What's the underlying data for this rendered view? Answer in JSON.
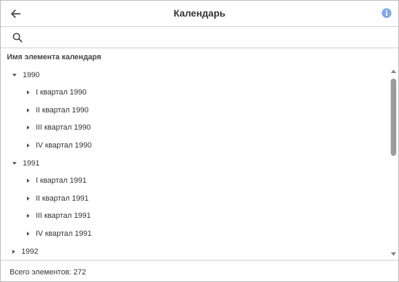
{
  "header": {
    "title": "Календарь",
    "back_icon": "arrow-left-icon",
    "info_icon": "info-circle-icon",
    "info_color": "#7fa9e6"
  },
  "search": {
    "icon": "search-icon",
    "value": "",
    "placeholder": ""
  },
  "tree": {
    "column_header": "Имя элемента календаря",
    "rows": [
      {
        "label": "1990",
        "expanded": true
      },
      {
        "label": "I квартал 1990",
        "expanded": false
      },
      {
        "label": "II квартал 1990",
        "expanded": false
      },
      {
        "label": "III квартал 1990",
        "expanded": false
      },
      {
        "label": "IV квартал 1990",
        "expanded": false
      },
      {
        "label": "1991",
        "expanded": true
      },
      {
        "label": "I квартал 1991",
        "expanded": false
      },
      {
        "label": "II квартал 1991",
        "expanded": false
      },
      {
        "label": "III квартал 1991",
        "expanded": false
      },
      {
        "label": "IV квартал 1991",
        "expanded": false
      },
      {
        "label": "1992",
        "expanded": false
      }
    ]
  },
  "footer": {
    "total_text": "Всего элементов: 272"
  }
}
